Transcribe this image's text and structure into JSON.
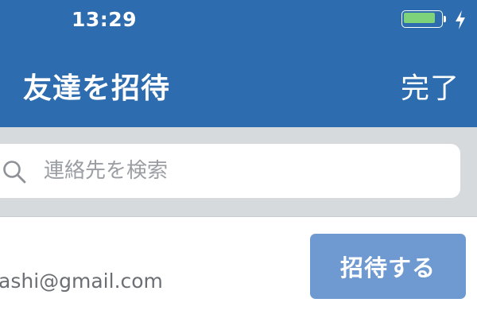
{
  "status_bar": {
    "time": "13:29",
    "battery_level": 0.9,
    "battery_color": "#7ed27a",
    "charging_icon": "lightning-bolt-icon"
  },
  "nav": {
    "title": "友達を招待",
    "done_label": "完了",
    "background_color": "#2d6cae"
  },
  "search": {
    "placeholder": "連絡先を検索",
    "value": "",
    "icon": "search-icon"
  },
  "contacts": [
    {
      "email": "ashi@gmail.com",
      "invite_label": "招待する",
      "invite_button_color": "#6f9ad1"
    }
  ]
}
